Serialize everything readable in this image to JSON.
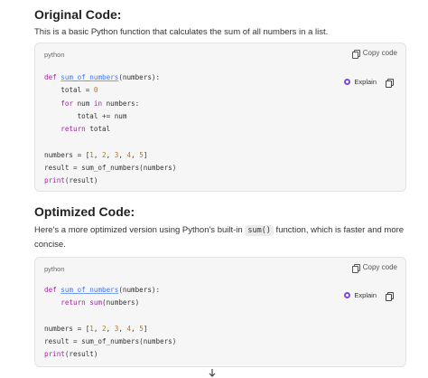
{
  "section1": {
    "heading": "Original Code:",
    "description": "This is a basic Python function that calculates the sum of all numbers in a list.",
    "code_block": {
      "language": "python",
      "copy_label": "Copy code",
      "explain_label": "Explain",
      "lines": {
        "l1_kw": "def",
        "l1_fn": "sum_of_numbers",
        "l1_rest": "(numbers):",
        "l2_a": "    total = ",
        "l2_num": "0",
        "l3_kw1": "for",
        "l3_a": " num ",
        "l3_kw2": "in",
        "l3_b": " numbers:",
        "l4": "        total += num",
        "l5_kw": "return",
        "l5_rest": " total",
        "l7_a": "numbers = [",
        "l7_n1": "1",
        "l7_n2": "2",
        "l7_n3": "3",
        "l7_n4": "4",
        "l7_n5": "5",
        "l7_end": "]",
        "l8": "result = sum_of_numbers(numbers)",
        "l9_bi": "print",
        "l9_rest": "(result)"
      }
    }
  },
  "section2": {
    "heading": "Optimized Code:",
    "description_pre": "Here's a more optimized version using Python's built-in ",
    "description_code": "sum()",
    "description_post": " function, which is faster and more",
    "description_line2": "concise.",
    "code_block": {
      "language": "python",
      "copy_label": "Copy code",
      "explain_label": "Explain",
      "lines": {
        "l1_kw": "def",
        "l1_fn": "sum_of_numbers",
        "l1_rest": "(numbers):",
        "l2_kw": "return",
        "l2_bi": "sum",
        "l2_rest": "(numbers)",
        "l4_a": "numbers = [",
        "l4_n1": "1",
        "l4_n2": "2",
        "l4_n3": "3",
        "l4_n4": "4",
        "l4_n5": "5",
        "l4_end": "]",
        "l5": "result = sum_of_numbers(numbers)",
        "l6_bi": "print",
        "l6_rest": "(result)"
      }
    }
  },
  "icons": {
    "copy": "copy-icon",
    "explain": "explain-icon",
    "scroll_down": "arrow-down-icon"
  },
  "colors": {
    "keyword": "#a626a4",
    "function": "#4078f2",
    "number": "#b0781a",
    "explain_accent": "#7b4bd6",
    "code_bg": "#f6f6f6"
  }
}
